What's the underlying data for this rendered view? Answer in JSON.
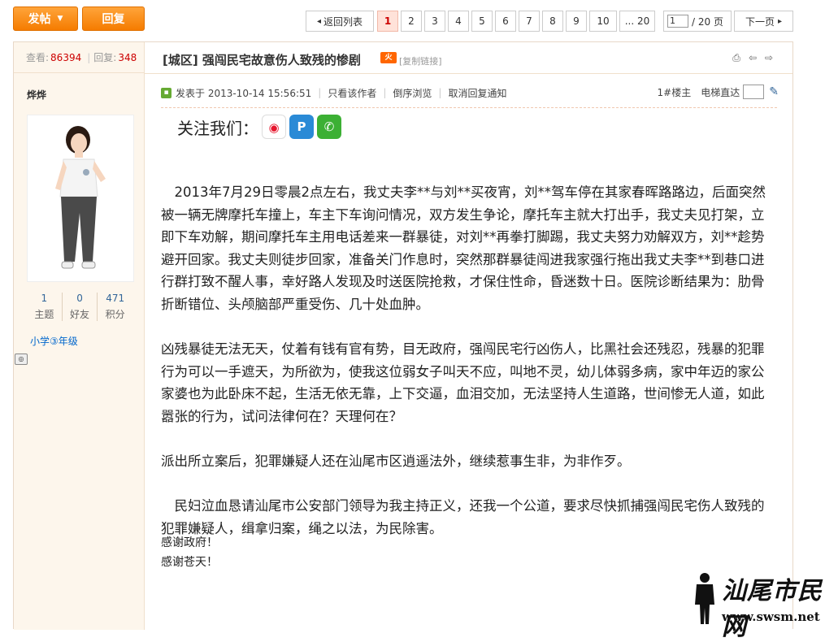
{
  "toolbar": {
    "post_label": "发帖",
    "reply_label": "回复"
  },
  "pagination": {
    "back_label": "返回列表",
    "pages": [
      "1",
      "2",
      "3",
      "4",
      "5",
      "6",
      "7",
      "8",
      "9",
      "10"
    ],
    "current_page": "1",
    "last_label": "... 20",
    "jump_value": "1",
    "total_label": "/ 20 页",
    "next_label": "下一页"
  },
  "thread": {
    "views_label": "查看:",
    "views": "86394",
    "replies_label": "回复:",
    "replies": "348",
    "title": "[城区] 强闯民宅故意伤人致残的惨剧",
    "copy_link": "[复制链接]"
  },
  "author": {
    "name": "烨烨",
    "stats": [
      {
        "value": "1",
        "label": "主题"
      },
      {
        "value": "0",
        "label": "好友"
      },
      {
        "value": "471",
        "label": "积分"
      }
    ],
    "grade": "小学③年级"
  },
  "post_meta": {
    "posted_at": "发表于 2013-10-14 15:56:51",
    "only_author": "只看该作者",
    "reverse_order": "倒序浏览",
    "cancel_notify": "取消回复通知",
    "floor": "1#楼主",
    "elevator": "电梯直达"
  },
  "follow_label": "关注我们：",
  "body": {
    "p1": "　2013年7月29日零晨2点左右，我丈夫李**与刘**买夜宵，刘**驾车停在其家春晖路路边，后面突然被一辆无牌摩托车撞上，车主下车询问情况，双方发生争论，摩托车主就大打出手，我丈夫见打架，立即下车劝解，期间摩托车主用电话差来一群暴徒，对刘**再拳打脚踢，我丈夫努力劝解双方，刘**趁势避开回家。我丈夫则徒步回家，准备关门作息时，突然那群暴徒闯进我家强行拖出我丈夫李**到巷口进行群打致不醒人事，幸好路人发现及时送医院抢救，才保住性命，昏迷数十日。医院诊断结果为：肋骨折断错位、头颅脑部严重受伤、几十处血肿。",
    "p2": "凶残暴徒无法无天，仗着有钱有官有势，目无政府，强闯民宅行凶伤人，比黑社会还残忍，残暴的犯罪行为可以一手遮天，为所欲为，使我这位弱女子叫天不应，叫地不灵，幼儿体弱多病，家中年迈的家公家婆也为此卧床不起，生活无依无靠，上下交逼，血泪交加，无法坚持人生道路，世间惨无人道，如此嚣张的行为，试问法律何在？天理何在？",
    "p3": "派出所立案后，犯罪嫌疑人还在汕尾市区逍遥法外，继续惹事生非，为非作歹。",
    "p4": "　民妇泣血恳请汕尾市公安部门领导为我主持正义，还我一个公道，要求尽快抓捕强闯民宅伤人致残的犯罪嫌疑人，缉拿归案，绳之以法，为民除害。",
    "thanks1": "感谢政府！",
    "thanks2": "感谢苍天！"
  },
  "watermark": {
    "title": "汕尾市民网",
    "url": "www.swsm.net"
  },
  "colors": {
    "accent_orange": "#f57c00",
    "sidebar_bg": "#fdf6ec",
    "highlight_red": "#cc0000"
  }
}
